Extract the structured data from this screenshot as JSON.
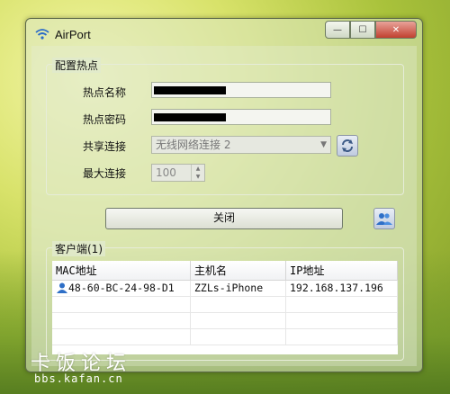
{
  "window": {
    "title": "AirPort",
    "min_glyph": "—",
    "max_glyph": "☐",
    "close_glyph": "✕"
  },
  "config_group": {
    "label": "配置热点",
    "ssid_label": "热点名称",
    "password_label": "热点密码",
    "share_label": "共享连接",
    "share_value": "无线网络连接 2",
    "max_label": "最大连接",
    "max_value": "100"
  },
  "close_button": "关闭",
  "clients_group": {
    "label": "客户端(1)",
    "columns": [
      "MAC地址",
      "主机名",
      "IP地址"
    ],
    "rows": [
      {
        "mac": "48-60-BC-24-98-D1",
        "host": "ZZLs-iPhone",
        "ip": "192.168.137.196"
      }
    ]
  },
  "watermark": {
    "text": "卡饭论坛",
    "url": "bbs.kafan.cn"
  },
  "icons": {
    "app": "wifi-icon",
    "refresh": "refresh-icon",
    "users": "users-icon",
    "client": "user-icon"
  }
}
